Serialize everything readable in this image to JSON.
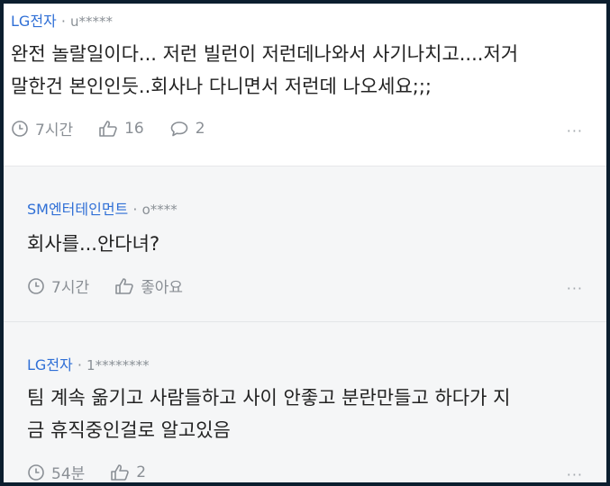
{
  "comments": [
    {
      "company": "LG전자",
      "separator": "·",
      "user": "u*****",
      "lines": [
        "완전 놀랄일이다... 저런 빌런이 저런데나와서 사기나치고....저거",
        "말한건 본인인듯..회사나 다니면서 저런데 나오세요;;;"
      ],
      "time": "7시간",
      "likes": "16",
      "replies": "2",
      "more": "···"
    },
    {
      "company": "SM엔터테인먼트",
      "separator": "·",
      "user": "o****",
      "lines": [
        "회사를...안다녀?"
      ],
      "time": "7시간",
      "likes": "좋아요",
      "more": "···"
    },
    {
      "company": "LG전자",
      "separator": "·",
      "user": "1********",
      "lines": [
        "팀 계속 옮기고 사람들하고 사이 안좋고 분란만들고 하다가 지",
        "금 휴직중인걸로 알고있음"
      ],
      "time": "54분",
      "likes": "2",
      "more": "···"
    }
  ],
  "icons": {
    "time": "clock-icon",
    "like": "thumbs-up-icon",
    "reply": "speech-bubble-icon",
    "more": "more-dots-icon"
  },
  "colors": {
    "author": "#2f6fd6",
    "meta": "#8a8f95",
    "text": "#222222",
    "reply_bg": "#f5f6f7"
  }
}
